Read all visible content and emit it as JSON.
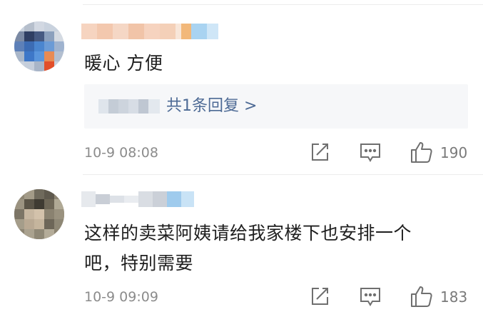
{
  "comments": [
    {
      "text": "暖心 方便",
      "reply_link": "共1条回复 >",
      "time": "10-9 08:08",
      "likes": "190"
    },
    {
      "text_line1": "这样的卖菜阿姨请给我家楼下也安排一个",
      "text_line2": "吧，特别需要",
      "time": "10-9 09:09",
      "likes": "183"
    }
  ],
  "icons": {
    "share": "share-icon",
    "comment": "comment-icon",
    "like": "thumbs-up-icon"
  }
}
